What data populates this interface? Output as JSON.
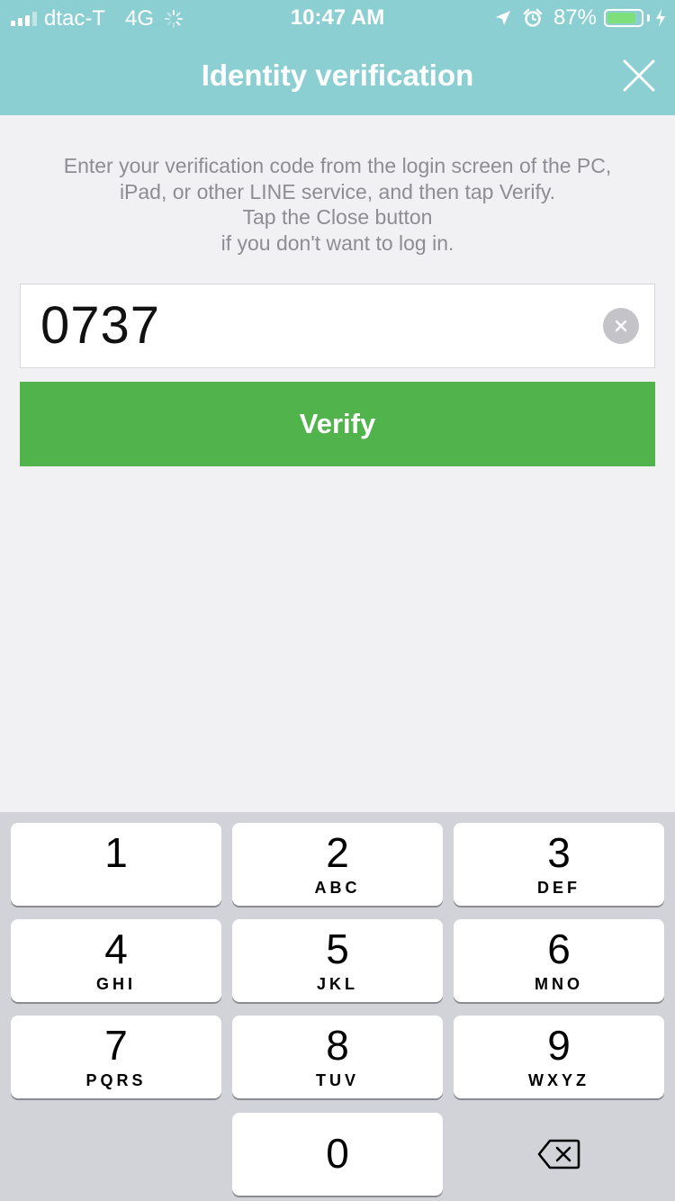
{
  "status_bar": {
    "carrier": "dtac-T",
    "network": "4G",
    "time": "10:47 AM",
    "battery_percent": "87%",
    "battery_level": 0.87
  },
  "header": {
    "title": "Identity verification"
  },
  "instructions": [
    "Enter your verification code from the login screen of the PC,",
    "iPad, or other LINE service, and then tap Verify.",
    "Tap the Close button",
    "if you don't want to log in."
  ],
  "code_input": {
    "value": "0737"
  },
  "verify_button": {
    "label": "Verify"
  },
  "keypad": {
    "keys": [
      {
        "num": "1",
        "letters": ""
      },
      {
        "num": "2",
        "letters": "ABC"
      },
      {
        "num": "3",
        "letters": "DEF"
      },
      {
        "num": "4",
        "letters": "GHI"
      },
      {
        "num": "5",
        "letters": "JKL"
      },
      {
        "num": "6",
        "letters": "MNO"
      },
      {
        "num": "7",
        "letters": "PQRS"
      },
      {
        "num": "8",
        "letters": "TUV"
      },
      {
        "num": "9",
        "letters": "WXYZ"
      },
      {
        "num": "0",
        "letters": ""
      }
    ]
  },
  "colors": {
    "header_bg": "#8ccfd3",
    "verify_bg": "#51b34c",
    "page_bg": "#f1f1f3",
    "keypad_bg": "#d1d3d9"
  }
}
